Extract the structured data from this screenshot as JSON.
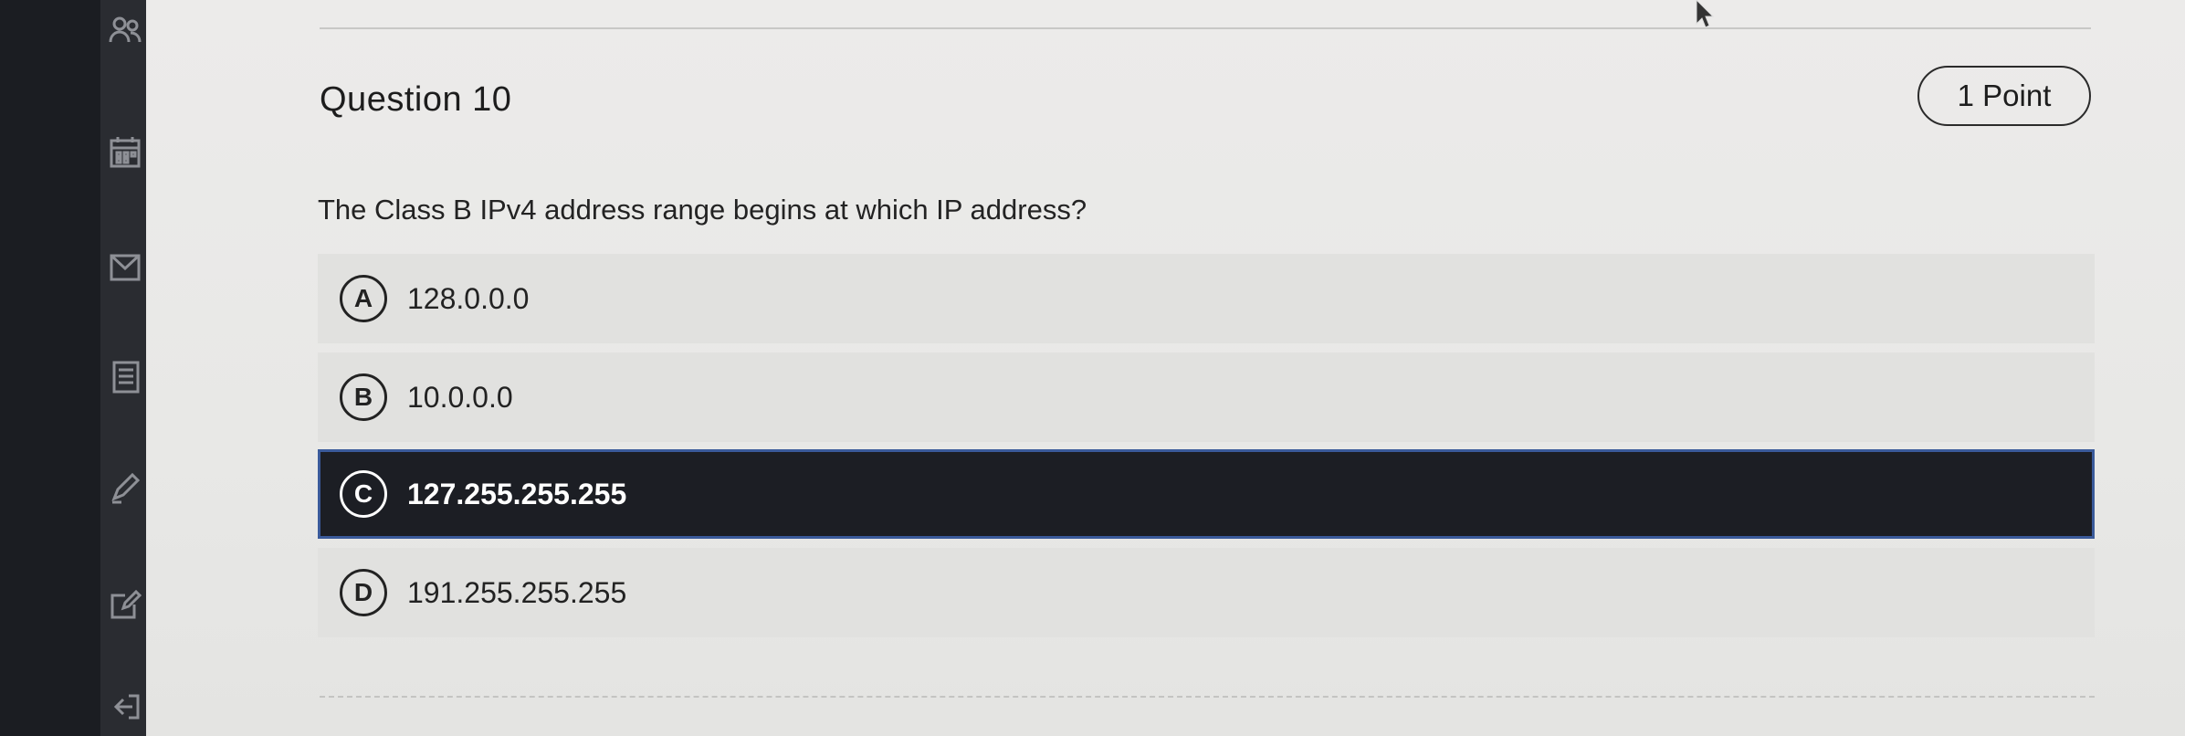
{
  "sidebar": {
    "icons": [
      "people-icon",
      "calendar-icon",
      "mail-icon",
      "document-icon",
      "pencil-icon",
      "edit-icon",
      "logout-icon"
    ]
  },
  "question": {
    "title": "Question 10",
    "points": "1 Point",
    "text": "The Class B IPv4 address range begins at which IP address?"
  },
  "options": [
    {
      "letter": "A",
      "answer": "128.0.0.0",
      "selected": false
    },
    {
      "letter": "B",
      "answer": "10.0.0.0",
      "selected": false
    },
    {
      "letter": "C",
      "answer": "127.255.255.255",
      "selected": true
    },
    {
      "letter": "D",
      "answer": "191.255.255.255",
      "selected": false
    }
  ],
  "colors": {
    "selected_bg": "#1c1e24",
    "selected_border": "#3a5a9a",
    "option_bg": "#e1e1df",
    "sidebar_bg": "#1b1d22"
  }
}
